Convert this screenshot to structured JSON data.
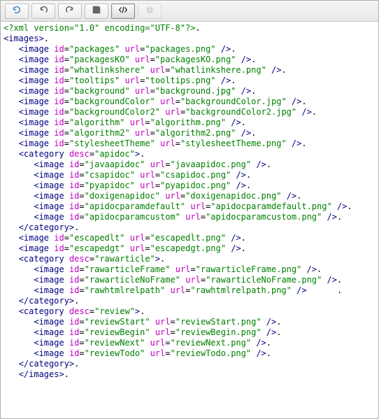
{
  "toolbar": {
    "buttons": [
      {
        "name": "refresh-button",
        "icon": "refresh-icon",
        "active": false,
        "disabled": false
      },
      {
        "name": "undo-button",
        "icon": "undo-icon",
        "active": false,
        "disabled": false
      },
      {
        "name": "redo-button",
        "icon": "redo-icon",
        "active": false,
        "disabled": false
      },
      {
        "name": "save-button",
        "icon": "save-icon",
        "active": false,
        "disabled": false
      },
      {
        "name": "source-button",
        "icon": "code-icon",
        "active": true,
        "disabled": false
      },
      {
        "name": "preview-button",
        "icon": "preview-icon",
        "active": false,
        "disabled": true
      }
    ]
  },
  "xml": {
    "declaration": "<?xml version=\"1.0\" encoding=\"UTF-8\"?>",
    "root": "images",
    "nodes": [
      {
        "t": "image",
        "indent": 1,
        "attrs": {
          "id": "packages",
          "url": "packages.png"
        },
        "self": true
      },
      {
        "t": "image",
        "indent": 1,
        "attrs": {
          "id": "packagesKO",
          "url": "packagesKO.png"
        },
        "self": true
      },
      {
        "t": "image",
        "indent": 1,
        "attrs": {
          "id": "whatlinkshere",
          "url": "whatlinkshere.png"
        },
        "self": true
      },
      {
        "t": "image",
        "indent": 1,
        "attrs": {
          "id": "tooltips",
          "url": "tooltips.png"
        },
        "self": true
      },
      {
        "t": "image",
        "indent": 1,
        "attrs": {
          "id": "background",
          "url": "background.jpg"
        },
        "self": true
      },
      {
        "t": "image",
        "indent": 1,
        "attrs": {
          "id": "backgroundColor",
          "url": "backgroundColor.jpg"
        },
        "self": true
      },
      {
        "t": "image",
        "indent": 1,
        "attrs": {
          "id": "backgroundColor2",
          "url": "backgroundColor2.jpg"
        },
        "self": true
      },
      {
        "t": "image",
        "indent": 1,
        "attrs": {
          "id": "algorithm",
          "url": "algorithm.png"
        },
        "self": true
      },
      {
        "t": "image",
        "indent": 1,
        "attrs": {
          "id": "algorithm2",
          "url": "algorithm2.png"
        },
        "self": true
      },
      {
        "t": "image",
        "indent": 1,
        "attrs": {
          "id": "stylesheetTheme",
          "url": "stylesheetTheme.png"
        },
        "self": true
      },
      {
        "t": "category",
        "indent": 1,
        "attrs": {
          "desc": "apidoc"
        },
        "open": true
      },
      {
        "t": "image",
        "indent": 2,
        "attrs": {
          "id": "javaapidoc",
          "url": "javaapidoc.png"
        },
        "self": true
      },
      {
        "t": "image",
        "indent": 2,
        "attrs": {
          "id": "csapidoc",
          "url": "csapidoc.png"
        },
        "self": true
      },
      {
        "t": "image",
        "indent": 2,
        "attrs": {
          "id": "pyapidoc",
          "url": "pyapidoc.png"
        },
        "self": true
      },
      {
        "t": "image",
        "indent": 2,
        "attrs": {
          "id": "doxigenapidoc",
          "url": "doxigenapidoc.png"
        },
        "self": true
      },
      {
        "t": "image",
        "indent": 2,
        "attrs": {
          "id": "apidocparamdefault",
          "url": "apidocparamdefault.png"
        },
        "self": true
      },
      {
        "t": "image",
        "indent": 2,
        "attrs": {
          "id": "apidocparamcustom",
          "url": "apidocparamcustom.png"
        },
        "self": true
      },
      {
        "t": "category",
        "indent": 1,
        "close": true
      },
      {
        "t": "image",
        "indent": 1,
        "attrs": {
          "id": "escapedlt",
          "url": "escapedlt.png"
        },
        "self": true
      },
      {
        "t": "image",
        "indent": 1,
        "attrs": {
          "id": "escapedgt",
          "url": "escapedgt.png"
        },
        "self": true
      },
      {
        "t": "category",
        "indent": 1,
        "attrs": {
          "desc": "rawarticle"
        },
        "open": true
      },
      {
        "t": "image",
        "indent": 2,
        "attrs": {
          "id": "rawarticleFrame",
          "url": "rawarticleFrame.png"
        },
        "self": true
      },
      {
        "t": "image",
        "indent": 2,
        "attrs": {
          "id": "rawarticleNoFrame",
          "url": "rawarticleNoFrame.png"
        },
        "self": true
      },
      {
        "t": "image",
        "indent": 2,
        "attrs": {
          "id": "rawhtmlrelpath",
          "url": "rawhtmlrelpath.png"
        },
        "self": true,
        "trail": "      "
      },
      {
        "t": "category",
        "indent": 1,
        "close": true
      },
      {
        "t": "category",
        "indent": 1,
        "attrs": {
          "desc": "review"
        },
        "open": true
      },
      {
        "t": "image",
        "indent": 2,
        "attrs": {
          "id": "reviewStart",
          "url": "reviewStart.png"
        },
        "self": true
      },
      {
        "t": "image",
        "indent": 2,
        "attrs": {
          "id": "reviewBegin",
          "url": "reviewBegin.png"
        },
        "self": true
      },
      {
        "t": "image",
        "indent": 2,
        "attrs": {
          "id": "reviewNext",
          "url": "reviewNext.png"
        },
        "self": true
      },
      {
        "t": "image",
        "indent": 2,
        "attrs": {
          "id": "reviewTodo",
          "url": "reviewTodo.png"
        },
        "self": true
      },
      {
        "t": "category",
        "indent": 1,
        "close": true
      }
    ]
  }
}
